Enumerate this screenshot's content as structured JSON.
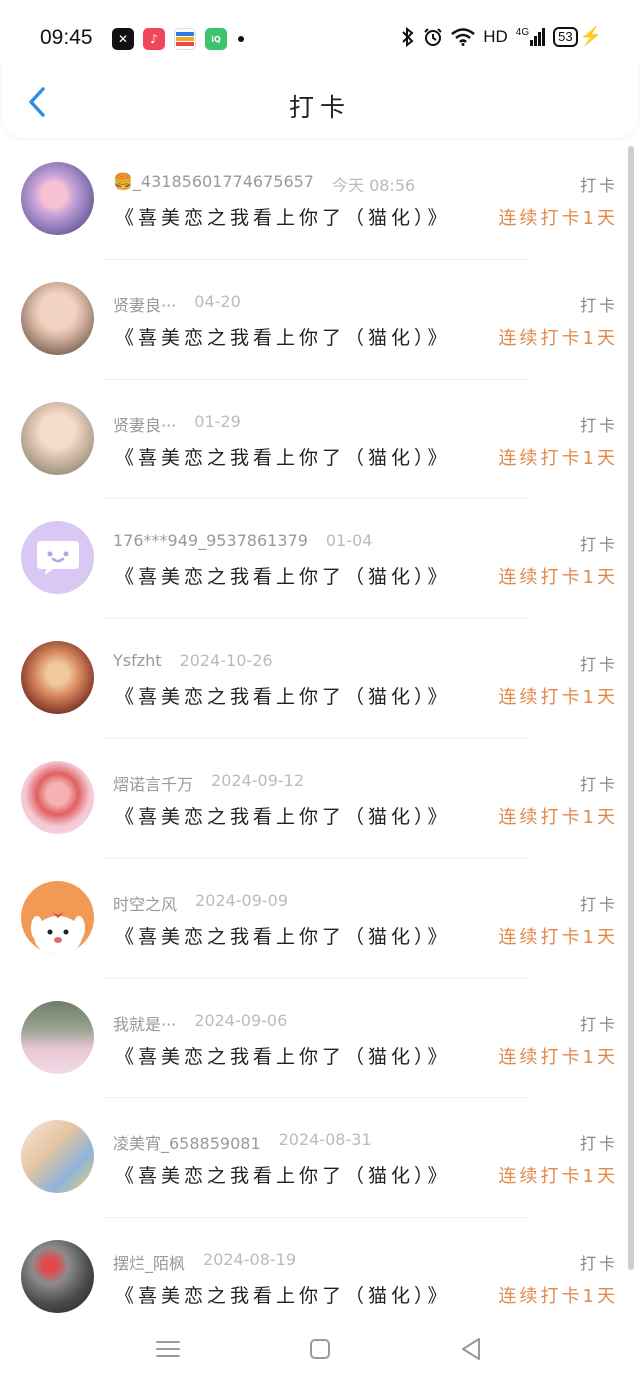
{
  "status_bar": {
    "time": "09:45",
    "network": "HD",
    "signal": "4G",
    "battery": "53"
  },
  "header": {
    "title": "打卡"
  },
  "entries": [
    {
      "user": "🍔_43185601774675657",
      "time": "今天 08:56",
      "book": "《喜美恋之我看上你了（猫化）》",
      "action": "打卡",
      "streak": "连续打卡1天"
    },
    {
      "user": "贤妻良···",
      "time": "04-20",
      "book": "《喜美恋之我看上你了（猫化）》",
      "action": "打卡",
      "streak": "连续打卡1天"
    },
    {
      "user": "贤妻良···",
      "time": "01-29",
      "book": "《喜美恋之我看上你了（猫化）》",
      "action": "打卡",
      "streak": "连续打卡1天"
    },
    {
      "user": "176***949_9537861379",
      "time": "01-04",
      "book": "《喜美恋之我看上你了（猫化）》",
      "action": "打卡",
      "streak": "连续打卡1天"
    },
    {
      "user": "Ysfzht",
      "time": "2024-10-26",
      "book": "《喜美恋之我看上你了（猫化）》",
      "action": "打卡",
      "streak": "连续打卡1天"
    },
    {
      "user": "熠诺言千万",
      "time": "2024-09-12",
      "book": "《喜美恋之我看上你了（猫化）》",
      "action": "打卡",
      "streak": "连续打卡1天"
    },
    {
      "user": "时空之风",
      "time": "2024-09-09",
      "book": "《喜美恋之我看上你了（猫化）》",
      "action": "打卡",
      "streak": "连续打卡1天"
    },
    {
      "user": "我就是···",
      "time": "2024-09-06",
      "book": "《喜美恋之我看上你了（猫化）》",
      "action": "打卡",
      "streak": "连续打卡1天"
    },
    {
      "user": "凌美宵_658859081",
      "time": "2024-08-31",
      "book": "《喜美恋之我看上你了（猫化）》",
      "action": "打卡",
      "streak": "连续打卡1天"
    },
    {
      "user": "摆烂_陌枫",
      "time": "2024-08-19",
      "book": "《喜美恋之我看上你了（猫化）》",
      "action": "打卡",
      "streak": "连续打卡1天"
    }
  ],
  "colors": {
    "accent": "#2f8fe0",
    "streak": "#e08a4c"
  }
}
